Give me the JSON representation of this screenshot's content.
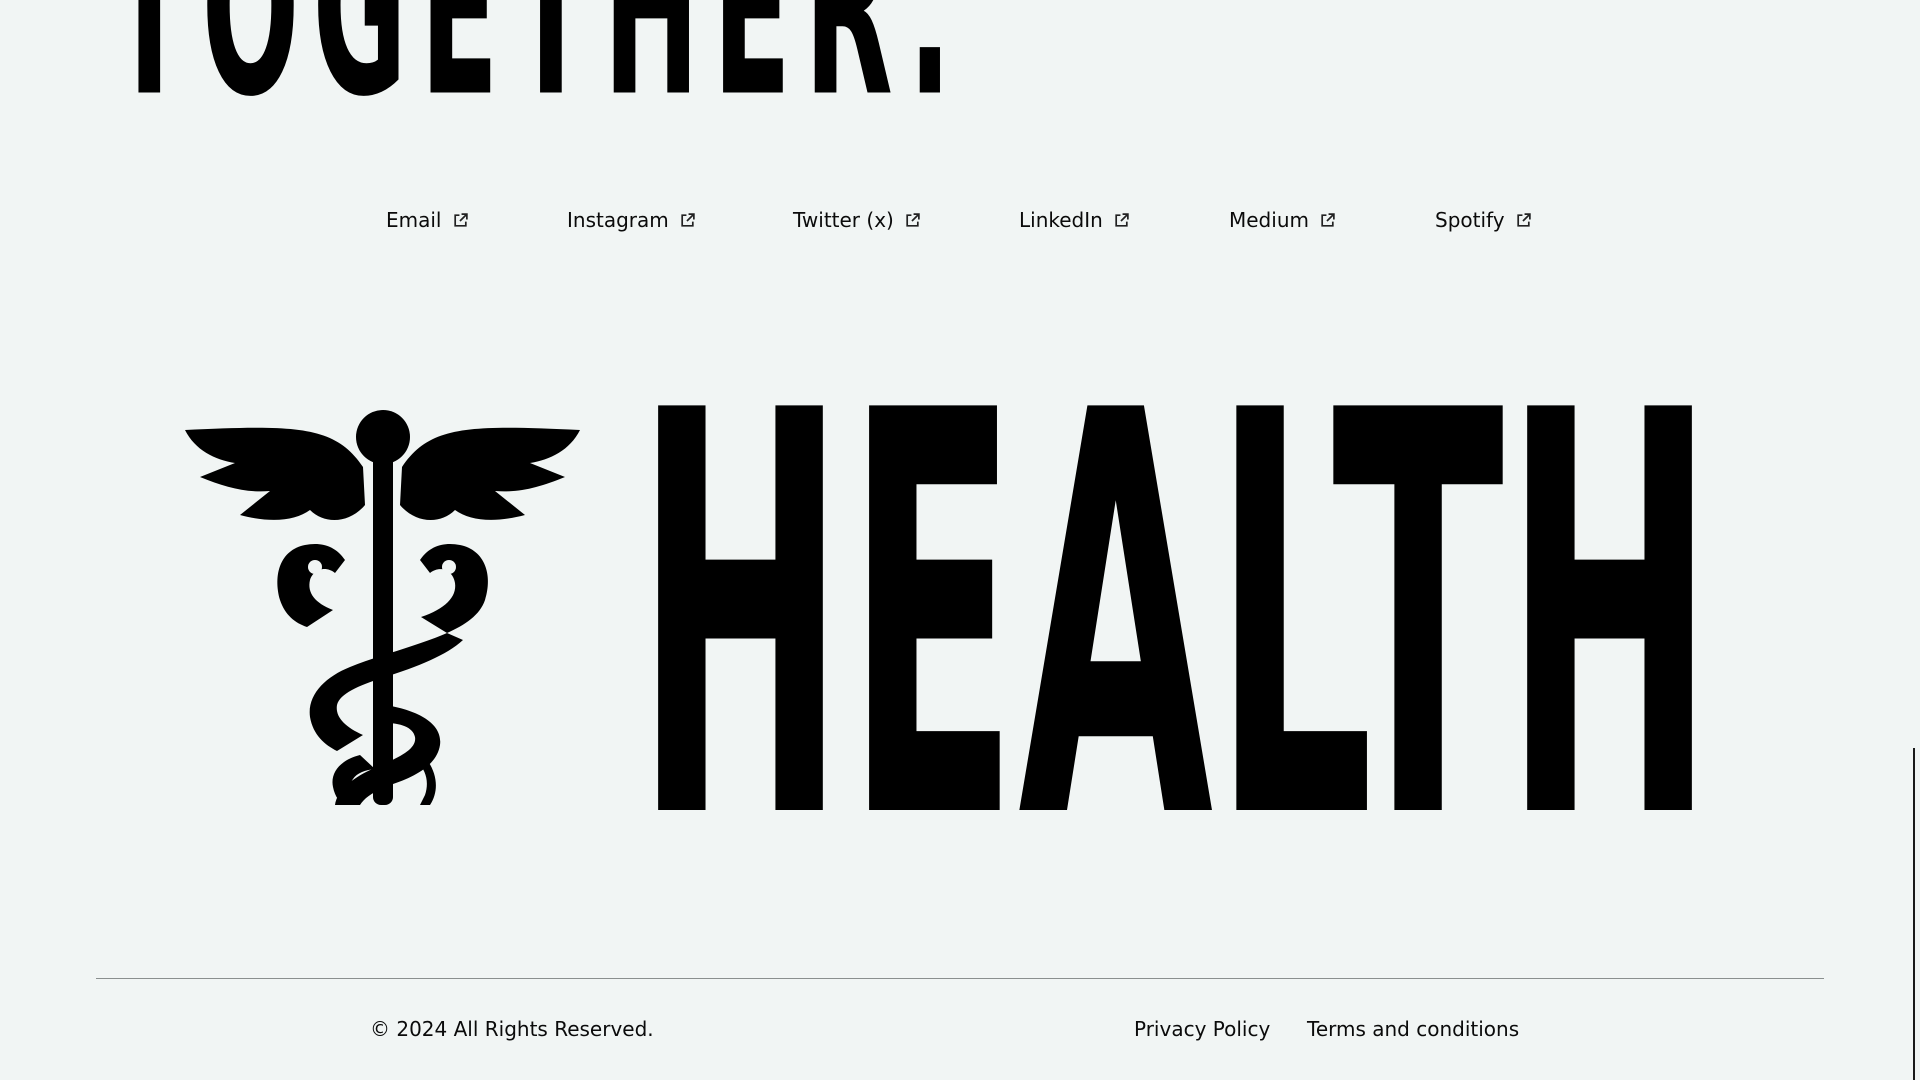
{
  "hero": {
    "tail_text": "TOGETHER."
  },
  "social_links": [
    {
      "label": "Email",
      "icon": "external-link-icon"
    },
    {
      "label": "Instagram",
      "icon": "external-link-icon"
    },
    {
      "label": "Twitter (x)",
      "icon": "external-link-icon"
    },
    {
      "label": "LinkedIn",
      "icon": "external-link-icon"
    },
    {
      "label": "Medium",
      "icon": "external-link-icon"
    },
    {
      "label": "Spotify",
      "icon": "external-link-icon"
    }
  ],
  "logo": {
    "icon": "caduceus-icon",
    "wordmark": "HEALTH"
  },
  "footer": {
    "copyright": "© 2024 All Rights Reserved.",
    "links": [
      {
        "label": "Privacy Policy"
      },
      {
        "label": "Terms and conditions"
      }
    ]
  },
  "colors": {
    "background": "#f1f5f4",
    "text": "#0b0b0b",
    "divider": "#8a8f8e"
  }
}
